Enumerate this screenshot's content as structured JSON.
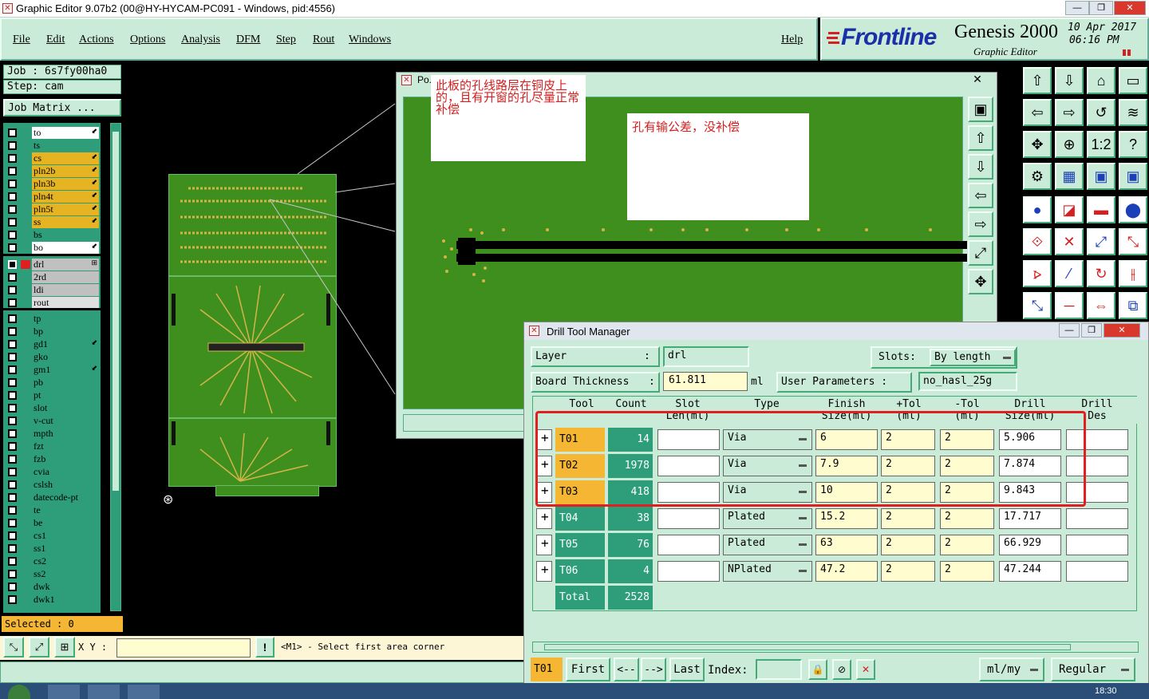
{
  "window": {
    "title": "Graphic Editor 9.07b2 (00@HY-HYCAM-PC091 - Windows, pid:4556)"
  },
  "menu": {
    "items": [
      "File",
      "Edit",
      "Actions",
      "Options",
      "Analysis",
      "DFM",
      "Step",
      "Rout",
      "Windows"
    ],
    "help": "Help"
  },
  "brand": {
    "name": "Frontline",
    "product": "Genesis 2000",
    "subtitle": "Graphic Editor",
    "date": "10 Apr 2017",
    "time": "06:16 PM",
    "accent": "#d42020"
  },
  "job": {
    "job_label": "Job : 6s7fy00ha0",
    "step_label": "Step: cam",
    "matrix_button": "Job Matrix ...",
    "selected": "Selected : 0"
  },
  "layers_board": [
    {
      "name": "to",
      "color": "#ffffff",
      "mark": "⬋"
    },
    {
      "name": "ts",
      "color": "#2e9e7a",
      "mark": ""
    },
    {
      "name": "cs",
      "color": "#e6b422",
      "mark": "⬋"
    },
    {
      "name": "pln2b",
      "color": "#e6b422",
      "mark": "⬋"
    },
    {
      "name": "pln3b",
      "color": "#e6b422",
      "mark": "⬋"
    },
    {
      "name": "pln4t",
      "color": "#e6b422",
      "mark": "⬋"
    },
    {
      "name": "pln5t",
      "color": "#e6b422",
      "mark": "⬋"
    },
    {
      "name": "ss",
      "color": "#e6b422",
      "mark": "⬋"
    },
    {
      "name": "bs",
      "color": "#2e9e7a",
      "mark": ""
    },
    {
      "name": "bo",
      "color": "#ffffff",
      "mark": "⬋"
    }
  ],
  "layers_drill": [
    {
      "name": "drl",
      "color": "#c0c0c0",
      "mark": "⊞"
    },
    {
      "name": "2rd",
      "color": "#c0c0c0",
      "mark": ""
    },
    {
      "name": "ldi",
      "color": "#c0c0c0",
      "mark": ""
    },
    {
      "name": "rout",
      "color": "#e0e0e0",
      "mark": ""
    }
  ],
  "layers_misc": [
    {
      "name": "tp",
      "mark": ""
    },
    {
      "name": "bp",
      "mark": ""
    },
    {
      "name": "gd1",
      "mark": "⬋"
    },
    {
      "name": "gko",
      "mark": ""
    },
    {
      "name": "gm1",
      "mark": "⬋"
    },
    {
      "name": "pb",
      "mark": ""
    },
    {
      "name": "pt",
      "mark": ""
    },
    {
      "name": "slot",
      "mark": ""
    },
    {
      "name": "v-cut",
      "mark": ""
    },
    {
      "name": "mpth",
      "mark": ""
    },
    {
      "name": "fzt",
      "mark": ""
    },
    {
      "name": "fzb",
      "mark": ""
    },
    {
      "name": "cvia",
      "mark": ""
    },
    {
      "name": "cslsh",
      "mark": ""
    },
    {
      "name": "datecode-pt",
      "mark": ""
    },
    {
      "name": "te",
      "mark": ""
    },
    {
      "name": "be",
      "mark": ""
    },
    {
      "name": "cs1",
      "mark": ""
    },
    {
      "name": "ss1",
      "mark": ""
    },
    {
      "name": "cs2",
      "mark": ""
    },
    {
      "name": "ss2",
      "mark": ""
    },
    {
      "name": "dwk",
      "mark": ""
    },
    {
      "name": "dwk1",
      "mark": ""
    }
  ],
  "zoom_window": {
    "title": "Po...",
    "note1": "此板的孔线路层在铜皮上的，且有开窗的孔尽量正常补偿",
    "note2": "孔有输公差，没补偿"
  },
  "status": {
    "xy_label": "X Y :",
    "xy_value": "",
    "message": "<M1> - Select first area corner"
  },
  "dtm": {
    "title": "Drill Tool Manager",
    "layer_label": "Layer",
    "layer_colon": ":",
    "layer_value": "drl",
    "slots_label": "Slots:",
    "slots_value": "By length",
    "thickness_label": "Board Thickness",
    "thickness_colon": ":",
    "thickness_value": "61.811",
    "thickness_unit": "ml",
    "userparams_label": "User Parameters :",
    "userparams_value": "no_hasl_25g",
    "columns": [
      {
        "l1": "Tool",
        "l2": ""
      },
      {
        "l1": "Count",
        "l2": ""
      },
      {
        "l1": "Slot",
        "l2": "Len(ml)"
      },
      {
        "l1": "Type",
        "l2": ""
      },
      {
        "l1": "Finish",
        "l2": "Size(ml)"
      },
      {
        "l1": "+Tol",
        "l2": "(ml)"
      },
      {
        "l1": "-Tol",
        "l2": "(ml)"
      },
      {
        "l1": "Drill",
        "l2": "Size(ml)"
      },
      {
        "l1": "Drill",
        "l2": "Des"
      }
    ],
    "rows": [
      {
        "tool": "T01",
        "count": "14",
        "slot": "",
        "type": "Via",
        "finish": "6",
        "ptol": "2",
        "ntol": "2",
        "drill": "5.906",
        "des": ""
      },
      {
        "tool": "T02",
        "count": "1978",
        "slot": "",
        "type": "Via",
        "finish": "7.9",
        "ptol": "2",
        "ntol": "2",
        "drill": "7.874",
        "des": ""
      },
      {
        "tool": "T03",
        "count": "418",
        "slot": "",
        "type": "Via",
        "finish": "10",
        "ptol": "2",
        "ntol": "2",
        "drill": "9.843",
        "des": ""
      },
      {
        "tool": "T04",
        "count": "38",
        "slot": "",
        "type": "Plated",
        "finish": "15.2",
        "ptol": "2",
        "ntol": "2",
        "drill": "17.717",
        "des": ""
      },
      {
        "tool": "T05",
        "count": "76",
        "slot": "",
        "type": "Plated",
        "finish": "63",
        "ptol": "2",
        "ntol": "2",
        "drill": "66.929",
        "des": ""
      },
      {
        "tool": "T06",
        "count": "4",
        "slot": "",
        "type": "NPlated",
        "finish": "47.2",
        "ptol": "2",
        "ntol": "2",
        "drill": "47.244",
        "des": ""
      }
    ],
    "total_label": "Total",
    "total_value": "2528",
    "footer": {
      "current": "T01",
      "first": "First",
      "prev": "<--",
      "next": "-->",
      "last": "Last",
      "index": "Index:",
      "units": "ml/my",
      "mode": "Regular"
    }
  },
  "taskbar": {
    "clock": "18:30"
  }
}
